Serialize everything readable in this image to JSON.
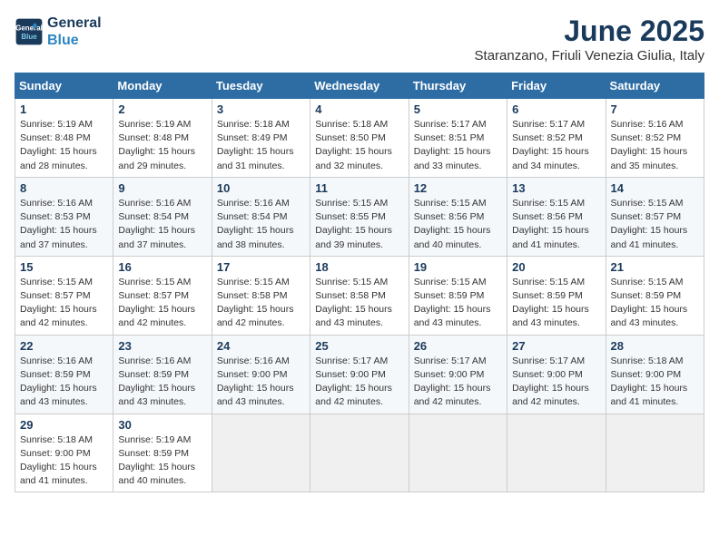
{
  "logo": {
    "line1": "General",
    "line2": "Blue"
  },
  "title": "June 2025",
  "subtitle": "Staranzano, Friuli Venezia Giulia, Italy",
  "headers": [
    "Sunday",
    "Monday",
    "Tuesday",
    "Wednesday",
    "Thursday",
    "Friday",
    "Saturday"
  ],
  "weeks": [
    [
      {
        "day": "1",
        "detail": "Sunrise: 5:19 AM\nSunset: 8:48 PM\nDaylight: 15 hours\nand 28 minutes."
      },
      {
        "day": "2",
        "detail": "Sunrise: 5:19 AM\nSunset: 8:48 PM\nDaylight: 15 hours\nand 29 minutes."
      },
      {
        "day": "3",
        "detail": "Sunrise: 5:18 AM\nSunset: 8:49 PM\nDaylight: 15 hours\nand 31 minutes."
      },
      {
        "day": "4",
        "detail": "Sunrise: 5:18 AM\nSunset: 8:50 PM\nDaylight: 15 hours\nand 32 minutes."
      },
      {
        "day": "5",
        "detail": "Sunrise: 5:17 AM\nSunset: 8:51 PM\nDaylight: 15 hours\nand 33 minutes."
      },
      {
        "day": "6",
        "detail": "Sunrise: 5:17 AM\nSunset: 8:52 PM\nDaylight: 15 hours\nand 34 minutes."
      },
      {
        "day": "7",
        "detail": "Sunrise: 5:16 AM\nSunset: 8:52 PM\nDaylight: 15 hours\nand 35 minutes."
      }
    ],
    [
      {
        "day": "8",
        "detail": "Sunrise: 5:16 AM\nSunset: 8:53 PM\nDaylight: 15 hours\nand 37 minutes."
      },
      {
        "day": "9",
        "detail": "Sunrise: 5:16 AM\nSunset: 8:54 PM\nDaylight: 15 hours\nand 37 minutes."
      },
      {
        "day": "10",
        "detail": "Sunrise: 5:16 AM\nSunset: 8:54 PM\nDaylight: 15 hours\nand 38 minutes."
      },
      {
        "day": "11",
        "detail": "Sunrise: 5:15 AM\nSunset: 8:55 PM\nDaylight: 15 hours\nand 39 minutes."
      },
      {
        "day": "12",
        "detail": "Sunrise: 5:15 AM\nSunset: 8:56 PM\nDaylight: 15 hours\nand 40 minutes."
      },
      {
        "day": "13",
        "detail": "Sunrise: 5:15 AM\nSunset: 8:56 PM\nDaylight: 15 hours\nand 41 minutes."
      },
      {
        "day": "14",
        "detail": "Sunrise: 5:15 AM\nSunset: 8:57 PM\nDaylight: 15 hours\nand 41 minutes."
      }
    ],
    [
      {
        "day": "15",
        "detail": "Sunrise: 5:15 AM\nSunset: 8:57 PM\nDaylight: 15 hours\nand 42 minutes."
      },
      {
        "day": "16",
        "detail": "Sunrise: 5:15 AM\nSunset: 8:57 PM\nDaylight: 15 hours\nand 42 minutes."
      },
      {
        "day": "17",
        "detail": "Sunrise: 5:15 AM\nSunset: 8:58 PM\nDaylight: 15 hours\nand 42 minutes."
      },
      {
        "day": "18",
        "detail": "Sunrise: 5:15 AM\nSunset: 8:58 PM\nDaylight: 15 hours\nand 43 minutes."
      },
      {
        "day": "19",
        "detail": "Sunrise: 5:15 AM\nSunset: 8:59 PM\nDaylight: 15 hours\nand 43 minutes."
      },
      {
        "day": "20",
        "detail": "Sunrise: 5:15 AM\nSunset: 8:59 PM\nDaylight: 15 hours\nand 43 minutes."
      },
      {
        "day": "21",
        "detail": "Sunrise: 5:15 AM\nSunset: 8:59 PM\nDaylight: 15 hours\nand 43 minutes."
      }
    ],
    [
      {
        "day": "22",
        "detail": "Sunrise: 5:16 AM\nSunset: 8:59 PM\nDaylight: 15 hours\nand 43 minutes."
      },
      {
        "day": "23",
        "detail": "Sunrise: 5:16 AM\nSunset: 8:59 PM\nDaylight: 15 hours\nand 43 minutes."
      },
      {
        "day": "24",
        "detail": "Sunrise: 5:16 AM\nSunset: 9:00 PM\nDaylight: 15 hours\nand 43 minutes."
      },
      {
        "day": "25",
        "detail": "Sunrise: 5:17 AM\nSunset: 9:00 PM\nDaylight: 15 hours\nand 42 minutes."
      },
      {
        "day": "26",
        "detail": "Sunrise: 5:17 AM\nSunset: 9:00 PM\nDaylight: 15 hours\nand 42 minutes."
      },
      {
        "day": "27",
        "detail": "Sunrise: 5:17 AM\nSunset: 9:00 PM\nDaylight: 15 hours\nand 42 minutes."
      },
      {
        "day": "28",
        "detail": "Sunrise: 5:18 AM\nSunset: 9:00 PM\nDaylight: 15 hours\nand 41 minutes."
      }
    ],
    [
      {
        "day": "29",
        "detail": "Sunrise: 5:18 AM\nSunset: 9:00 PM\nDaylight: 15 hours\nand 41 minutes."
      },
      {
        "day": "30",
        "detail": "Sunrise: 5:19 AM\nSunset: 8:59 PM\nDaylight: 15 hours\nand 40 minutes."
      },
      {
        "day": "",
        "detail": ""
      },
      {
        "day": "",
        "detail": ""
      },
      {
        "day": "",
        "detail": ""
      },
      {
        "day": "",
        "detail": ""
      },
      {
        "day": "",
        "detail": ""
      }
    ]
  ]
}
